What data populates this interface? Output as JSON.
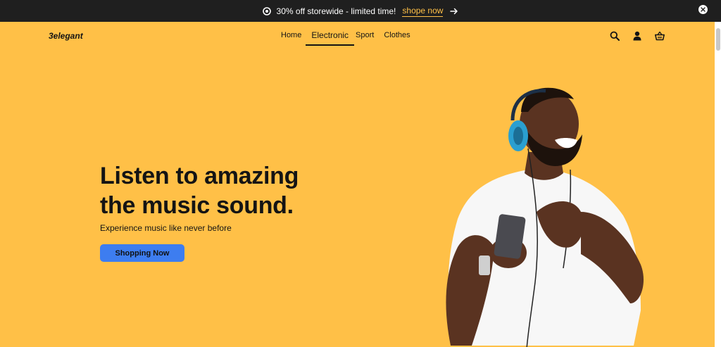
{
  "announcement": {
    "text": "30% off storewide - limited time!",
    "link_label": "shope now",
    "icons": [
      "ticket-icon",
      "arrow-right-icon",
      "close-icon"
    ]
  },
  "header": {
    "logo": "3elegant",
    "nav": [
      "Home",
      "Electronic",
      "Sport",
      "Clothes"
    ],
    "active_nav": "Electronic",
    "icons": [
      "search-icon",
      "user-icon",
      "basket-icon"
    ]
  },
  "hero": {
    "title_line1": "Listen to amazing",
    "title_line2": "the music sound.",
    "subtitle": "Experience music like never before",
    "cta_label": "Shopping Now"
  },
  "colors": {
    "topbar": "#1f1f1f",
    "hero_background": "#ffc047",
    "accent": "#ffc047",
    "button": "#3d7df0",
    "text": "#141414"
  }
}
